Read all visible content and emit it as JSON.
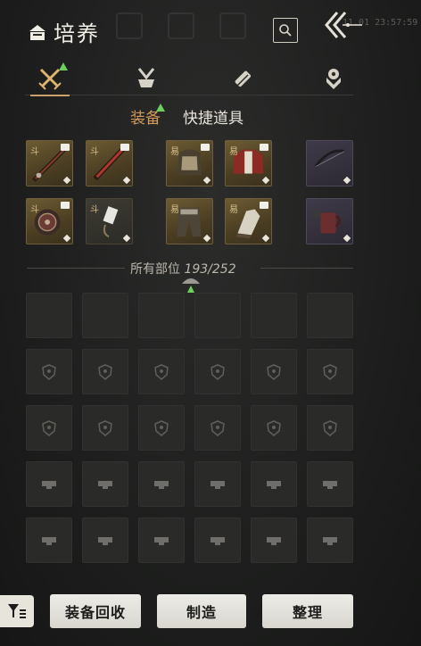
{
  "header": {
    "title": "培养",
    "timestamp": "11.01 23:57:59",
    "title_icon": "cultivate-icon",
    "search_icon": "search-icon",
    "back_icon": "back-chevrons-icon"
  },
  "category_tabs": [
    {
      "icon": "crossed-swords-icon",
      "active": true,
      "has_alert": true
    },
    {
      "icon": "shuttlecock-icon",
      "active": false,
      "has_alert": false
    },
    {
      "icon": "scroll-icon",
      "active": false,
      "has_alert": false
    },
    {
      "icon": "token-icon",
      "active": false,
      "has_alert": false
    }
  ],
  "sub_tabs": {
    "equipment": "装备",
    "quick_items": "快捷道具"
  },
  "equipped": {
    "row1": [
      {
        "tag": "斗",
        "art": "spear-icon",
        "style": "gold"
      },
      {
        "tag": "斗",
        "art": "red-blade-icon",
        "style": "gold"
      },
      {
        "tag": "易",
        "art": "armor-icon",
        "style": "gold"
      },
      {
        "tag": "易",
        "art": "red-coat-icon",
        "style": "gold"
      },
      {
        "tag": "",
        "art": "bow-icon",
        "style": "purple"
      }
    ],
    "row2": [
      {
        "tag": "斗",
        "art": "shield-icon",
        "style": "gold"
      },
      {
        "tag": "斗",
        "art": "blade-icon",
        "style": "dark"
      },
      {
        "tag": "易",
        "art": "pants-icon",
        "style": "gold"
      },
      {
        "tag": "易",
        "art": "boots-icon",
        "style": "gold"
      },
      {
        "tag": "",
        "art": "mug-icon",
        "style": "purple"
      }
    ]
  },
  "inventory": {
    "label": "所有部位",
    "count": "193/252",
    "rows": [
      {
        "icon": "empty"
      },
      {
        "icon": "armor-slot-icon"
      },
      {
        "icon": "armor-slot-icon"
      },
      {
        "icon": "trinket-slot-icon"
      },
      {
        "icon": "trinket-slot-icon"
      }
    ]
  },
  "footer": {
    "filter_icon": "filter-list-icon",
    "recycle": "装备回收",
    "craft": "制造",
    "sort": "整理"
  },
  "colors": {
    "accent": "#d49a5a",
    "gold_border": "#6d5f3c",
    "alert": "#6fcf5e"
  }
}
